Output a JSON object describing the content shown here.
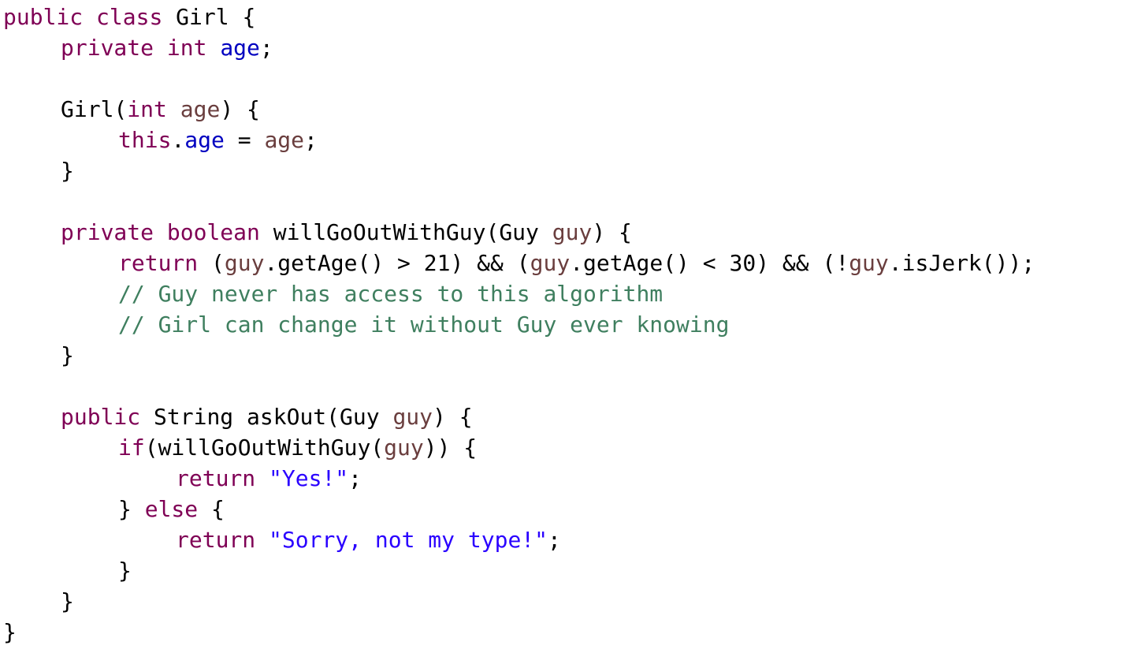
{
  "editor": {
    "colors": {
      "keyword": "#7f0055",
      "field": "#0000c0",
      "variable": "#6a3e3e",
      "string": "#2a00ff",
      "comment": "#3f7f5f",
      "plain": "#000000",
      "background": "#ffffff"
    },
    "lines": [
      {
        "indent": 0,
        "tokens": [
          {
            "t": "kw",
            "v": "public"
          },
          {
            "t": "plain",
            "v": " "
          },
          {
            "t": "kw",
            "v": "class"
          },
          {
            "t": "plain",
            "v": " Girl {"
          }
        ]
      },
      {
        "indent": 1,
        "tokens": [
          {
            "t": "kw",
            "v": "private"
          },
          {
            "t": "plain",
            "v": " "
          },
          {
            "t": "kw",
            "v": "int"
          },
          {
            "t": "plain",
            "v": " "
          },
          {
            "t": "field",
            "v": "age"
          },
          {
            "t": "plain",
            "v": ";"
          }
        ]
      },
      {
        "indent": 0,
        "tokens": []
      },
      {
        "indent": 1,
        "tokens": [
          {
            "t": "plain",
            "v": "Girl("
          },
          {
            "t": "kw",
            "v": "int"
          },
          {
            "t": "plain",
            "v": " "
          },
          {
            "t": "var",
            "v": "age"
          },
          {
            "t": "plain",
            "v": ") {"
          }
        ]
      },
      {
        "indent": 2,
        "tokens": [
          {
            "t": "kw",
            "v": "this"
          },
          {
            "t": "plain",
            "v": "."
          },
          {
            "t": "field",
            "v": "age"
          },
          {
            "t": "plain",
            "v": " = "
          },
          {
            "t": "var",
            "v": "age"
          },
          {
            "t": "plain",
            "v": ";"
          }
        ]
      },
      {
        "indent": 1,
        "tokens": [
          {
            "t": "plain",
            "v": "}"
          }
        ]
      },
      {
        "indent": 0,
        "tokens": []
      },
      {
        "indent": 1,
        "tokens": [
          {
            "t": "kw",
            "v": "private"
          },
          {
            "t": "plain",
            "v": " "
          },
          {
            "t": "kw",
            "v": "boolean"
          },
          {
            "t": "plain",
            "v": " willGoOutWithGuy(Guy "
          },
          {
            "t": "var",
            "v": "guy"
          },
          {
            "t": "plain",
            "v": ") {"
          }
        ]
      },
      {
        "indent": 2,
        "tokens": [
          {
            "t": "kw",
            "v": "return"
          },
          {
            "t": "plain",
            "v": " ("
          },
          {
            "t": "var",
            "v": "guy"
          },
          {
            "t": "plain",
            "v": ".getAge() > 21) && ("
          },
          {
            "t": "var",
            "v": "guy"
          },
          {
            "t": "plain",
            "v": ".getAge() < 30) && (!"
          },
          {
            "t": "var",
            "v": "guy"
          },
          {
            "t": "plain",
            "v": ".isJerk());"
          }
        ]
      },
      {
        "indent": 2,
        "tokens": [
          {
            "t": "comment",
            "v": "// Guy never has access to this algorithm"
          }
        ]
      },
      {
        "indent": 2,
        "tokens": [
          {
            "t": "comment",
            "v": "// Girl can change it without Guy ever knowing"
          }
        ]
      },
      {
        "indent": 1,
        "tokens": [
          {
            "t": "plain",
            "v": "}"
          }
        ]
      },
      {
        "indent": 0,
        "tokens": []
      },
      {
        "indent": 1,
        "tokens": [
          {
            "t": "kw",
            "v": "public"
          },
          {
            "t": "plain",
            "v": " String askOut(Guy "
          },
          {
            "t": "var",
            "v": "guy"
          },
          {
            "t": "plain",
            "v": ") {"
          }
        ]
      },
      {
        "indent": 2,
        "tokens": [
          {
            "t": "kw",
            "v": "if"
          },
          {
            "t": "plain",
            "v": "(willGoOutWithGuy("
          },
          {
            "t": "var",
            "v": "guy"
          },
          {
            "t": "plain",
            "v": ")) {"
          }
        ]
      },
      {
        "indent": 3,
        "tokens": [
          {
            "t": "kw",
            "v": "return"
          },
          {
            "t": "plain",
            "v": " "
          },
          {
            "t": "str",
            "v": "\"Yes!\""
          },
          {
            "t": "plain",
            "v": ";"
          }
        ]
      },
      {
        "indent": 2,
        "tokens": [
          {
            "t": "plain",
            "v": "} "
          },
          {
            "t": "kw",
            "v": "else"
          },
          {
            "t": "plain",
            "v": " {"
          }
        ]
      },
      {
        "indent": 3,
        "tokens": [
          {
            "t": "kw",
            "v": "return"
          },
          {
            "t": "plain",
            "v": " "
          },
          {
            "t": "str",
            "v": "\"Sorry, not my type!\""
          },
          {
            "t": "plain",
            "v": ";"
          }
        ]
      },
      {
        "indent": 2,
        "tokens": [
          {
            "t": "plain",
            "v": "}"
          }
        ]
      },
      {
        "indent": 1,
        "tokens": [
          {
            "t": "plain",
            "v": "}"
          }
        ]
      },
      {
        "indent": 0,
        "tokens": [
          {
            "t": "plain",
            "v": "}"
          }
        ]
      }
    ]
  }
}
